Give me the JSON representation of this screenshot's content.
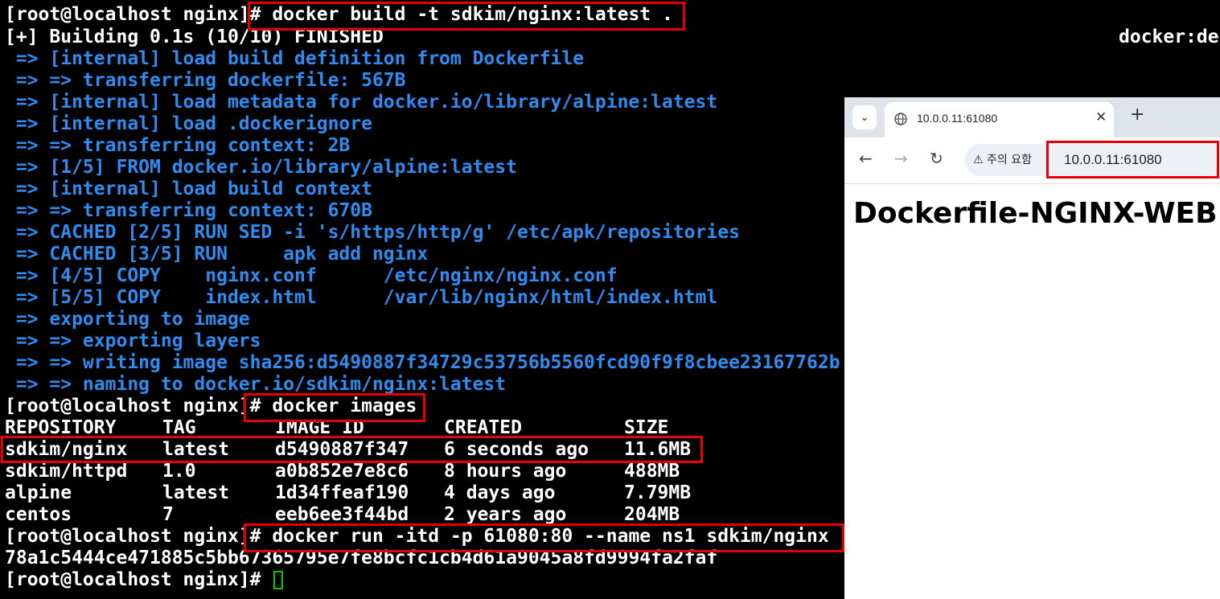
{
  "terminal": {
    "build_prompt": "[root@localhost nginx]",
    "build_command": "# docker build -t sdkim/nginx:latest .",
    "building_status": "[+] Building 0.1s (10/10) FINISHED",
    "docker_right": "docker:de",
    "build_steps": [
      " => [internal] load build definition from Dockerfile",
      " => => transferring dockerfile: 567B",
      " => [internal] load metadata for docker.io/library/alpine:latest",
      " => [internal] load .dockerignore",
      " => => transferring context: 2B",
      " => [1/5] FROM docker.io/library/alpine:latest",
      " => [internal] load build context",
      " => => transferring context: 670B",
      " => CACHED [2/5] RUN SED -i 's/https/http/g' /etc/apk/repositories",
      " => CACHED [3/5] RUN     apk add nginx",
      " => [4/5] COPY    nginx.conf      /etc/nginx/nginx.conf",
      " => [5/5] COPY    index.html      /var/lib/nginx/html/index.html",
      " => exporting to image",
      " => => exporting layers",
      " => => writing image sha256:d5490887f34729c53756b5560fcd90f9f8cbee23167762b",
      " => => naming to docker.io/sdkim/nginx:latest"
    ],
    "images_prompt": "[root@localhost nginx]",
    "images_command": "# docker images",
    "table_headers": [
      "REPOSITORY",
      "TAG",
      "IMAGE ID",
      "CREATED",
      "SIZE"
    ],
    "table_rows": [
      [
        "sdkim/nginx",
        "latest",
        "d5490887f347",
        "6 seconds ago",
        "11.6MB"
      ],
      [
        "sdkim/httpd",
        "1.0",
        "a0b852e7e8c6",
        "8 hours ago",
        "488MB"
      ],
      [
        "alpine",
        "latest",
        "1d34ffeaf190",
        "4 days ago",
        "7.79MB"
      ],
      [
        "centos",
        "7",
        "eeb6ee3f44bd",
        "2 years ago",
        "204MB"
      ]
    ],
    "run_prompt": "[root@localhost nginx]",
    "run_command": "# docker run -itd -p 61080:80 --name ns1 sdkim/nginx",
    "container_id": "78a1c5444ce471885c5bb67365795e7fe8bcfc1cb4d61a9045a8fd9994fa2faf",
    "final_prompt": "[root@localhost nginx]#",
    "colors": {
      "text": "#ffffff",
      "build_step": "#2f8cf0",
      "highlight": "#e80000",
      "cursor": "#00cc00"
    }
  },
  "browser": {
    "tab_title": "10.0.0.11:61080",
    "security_label": "주의 요함",
    "url": "10.0.0.11:61080",
    "page_heading": "Dockerfile-NGINX-WEB",
    "icons": [
      "tab-list-icon",
      "globe-icon",
      "close-icon",
      "plus-icon",
      "back-icon",
      "forward-icon",
      "reload-icon",
      "warning-icon"
    ]
  }
}
